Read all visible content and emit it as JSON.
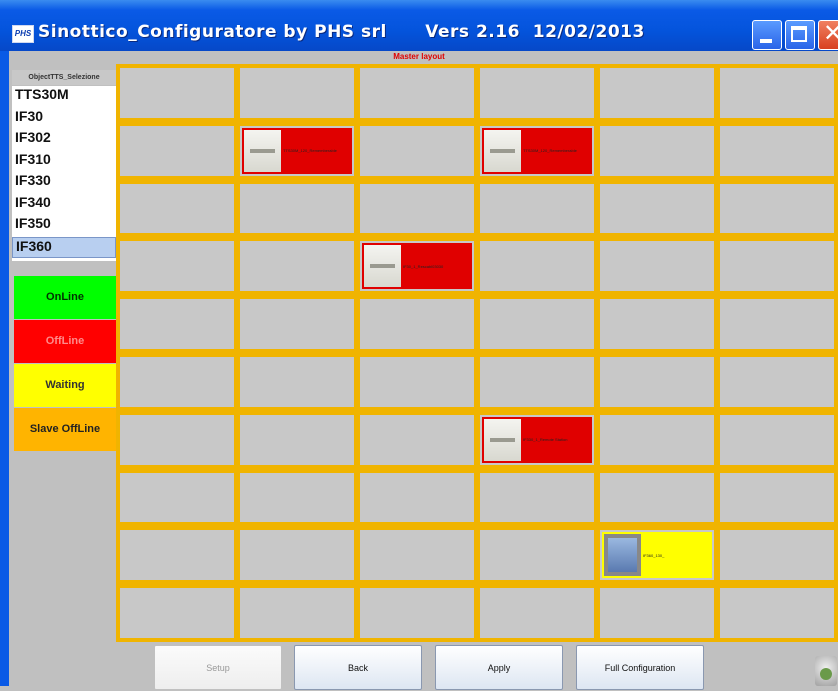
{
  "window": {
    "title": "Sinottico_Configuratore by PHS srl      Vers 2.16  12/02/2013",
    "app_icon_text": "PHS"
  },
  "layout_title": "Master layout",
  "selector": {
    "header": "ObjectTTS_Selezione",
    "items": [
      "TTS30M",
      "IF30",
      "IF302",
      "IF310",
      "IF330",
      "IF340",
      "IF350",
      "IF360"
    ],
    "selected": "IF360"
  },
  "legend": [
    {
      "label": "OnLine",
      "bg": "#00ff00",
      "fg": "#003300"
    },
    {
      "label": "OffLine",
      "bg": "#ff0000",
      "fg": "#ff8a8a"
    },
    {
      "label": "Waiting",
      "bg": "#ffff00",
      "fg": "#333333"
    },
    {
      "label": "Slave OffLine",
      "bg": "#ffb400",
      "fg": "#222222"
    }
  ],
  "grid": {
    "rows": 10,
    "cols": 6
  },
  "devices": [
    {
      "label": "TTS30M_120_Rememberable",
      "row": 1,
      "col": 1,
      "status": "offline",
      "thumb": "panel-icon"
    },
    {
      "label": "TTS30M_120_Rememberable",
      "row": 1,
      "col": 3,
      "status": "offline",
      "thumb": "panel-icon"
    },
    {
      "label": "IF30_1_Rescabl03030",
      "row": 3,
      "col": 2,
      "status": "offline",
      "thumb": "panel-icon"
    },
    {
      "label": "IF330_1_Remote Station",
      "row": 6,
      "col": 3,
      "status": "offline",
      "thumb": "keypad-icon"
    },
    {
      "label": "IF360_130_",
      "row": 8,
      "col": 4,
      "status": "waiting",
      "thumb": "screen-icon"
    }
  ],
  "buttons": {
    "setup": "Setup",
    "back": "Back",
    "apply": "Apply",
    "full_config": "Full Configuration"
  }
}
